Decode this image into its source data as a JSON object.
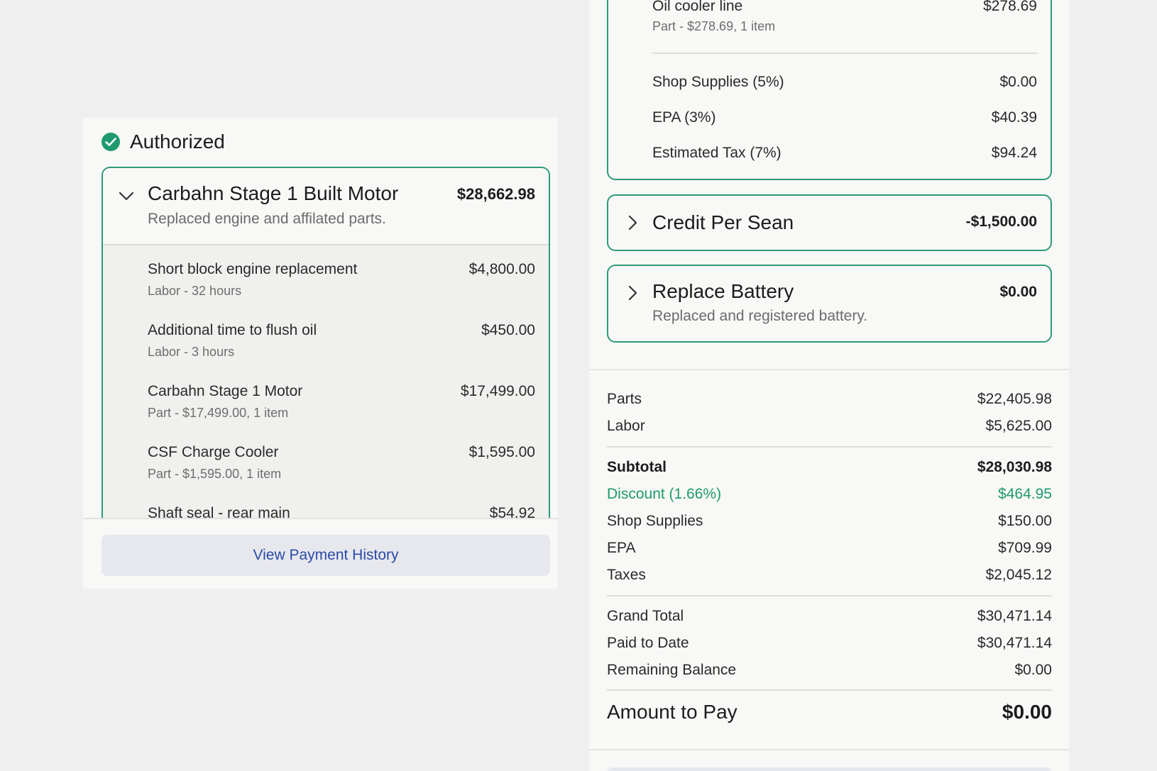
{
  "left": {
    "status_label": "Authorized",
    "job": {
      "title": "Carbahn Stage 1 Built Motor",
      "description": "Replaced engine and affilated parts.",
      "price": "$28,662.98",
      "lines": [
        {
          "name": "Short block engine replacement",
          "sub": "Labor - 32 hours",
          "price": "$4,800.00"
        },
        {
          "name": "Additional time to flush oil",
          "sub": "Labor - 3 hours",
          "price": "$450.00"
        },
        {
          "name": "Carbahn Stage 1 Motor",
          "sub": "Part - $17,499.00, 1 item",
          "price": "$17,499.00"
        },
        {
          "name": "CSF Charge Cooler",
          "sub": "Part - $1,595.00, 1 item",
          "price": "$1,595.00"
        },
        {
          "name": "Shaft seal - rear main",
          "sub": "",
          "price": "$54.92"
        }
      ]
    },
    "view_payment_history": "View Payment History"
  },
  "right": {
    "top_card": {
      "oil_name": "Oil cooler line",
      "oil_price": "$278.69",
      "oil_sub": "Part - $278.69, 1 item",
      "fees": [
        {
          "label": "Shop Supplies (5%)",
          "value": "$0.00"
        },
        {
          "label": "EPA (3%)",
          "value": "$40.39"
        },
        {
          "label": "Estimated Tax (7%)",
          "value": "$94.24"
        }
      ]
    },
    "credit": {
      "title": "Credit Per Sean",
      "price": "-$1,500.00"
    },
    "battery": {
      "title": "Replace Battery",
      "description": "Replaced and registered battery.",
      "price": "$0.00"
    },
    "summary": {
      "parts": {
        "label": "Parts",
        "value": "$22,405.98"
      },
      "labor": {
        "label": "Labor",
        "value": "$5,625.00"
      },
      "subtotal": {
        "label": "Subtotal",
        "value": "$28,030.98"
      },
      "discount": {
        "label": "Discount (1.66%)",
        "value": "$464.95"
      },
      "shop_supplies": {
        "label": "Shop Supplies",
        "value": "$150.00"
      },
      "epa": {
        "label": "EPA",
        "value": "$709.99"
      },
      "taxes": {
        "label": "Taxes",
        "value": "$2,045.12"
      },
      "grand_total": {
        "label": "Grand Total",
        "value": "$30,471.14"
      },
      "paid_to_date": {
        "label": "Paid to Date",
        "value": "$30,471.14"
      },
      "remaining_balance": {
        "label": "Remaining Balance",
        "value": "$0.00"
      },
      "amount_to_pay": {
        "label": "Amount to Pay",
        "value": "$0.00"
      }
    }
  },
  "colors": {
    "accent_green": "#2f9a78",
    "link_blue": "#2b4aa8",
    "button_bg": "#e7e8ee"
  },
  "icons": {
    "status": "check-circle-icon",
    "expand": "chevron-down-icon",
    "collapse": "chevron-right-icon"
  }
}
